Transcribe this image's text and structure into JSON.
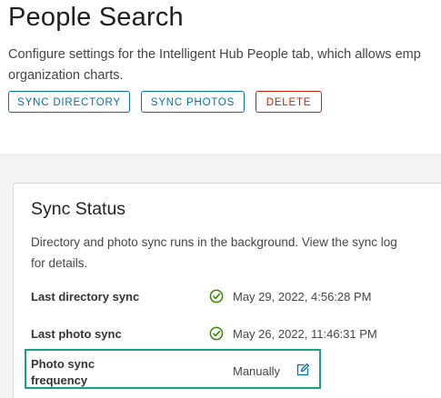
{
  "header": {
    "title": "People Search",
    "description_lines": [
      "Configure settings for the Intelligent Hub People tab, which allows emp",
      "organization charts."
    ]
  },
  "actions": {
    "sync_directory": "SYNC DIRECTORY",
    "sync_photos": "SYNC PHOTOS",
    "delete": "DELETE"
  },
  "sync_status": {
    "title": "Sync Status",
    "description_lines": [
      "Directory and photo sync runs in the background. View the sync log",
      "for details."
    ],
    "last_directory_sync": {
      "label": "Last directory sync",
      "value": "May 29, 2022, 4:56:28 PM",
      "status_icon": "check-circle-icon"
    },
    "last_photo_sync": {
      "label": "Last photo sync",
      "value": "May 26, 2022, 11:46:31 PM",
      "status_icon": "check-circle-icon"
    },
    "photo_sync_frequency": {
      "label_lines": [
        "Photo sync",
        "frequency"
      ],
      "value": "Manually",
      "edit_icon": "edit-icon"
    }
  },
  "colors": {
    "primary": "#0072a3",
    "danger": "#c92100",
    "success": "#3c8500",
    "highlight": "#18a085"
  }
}
